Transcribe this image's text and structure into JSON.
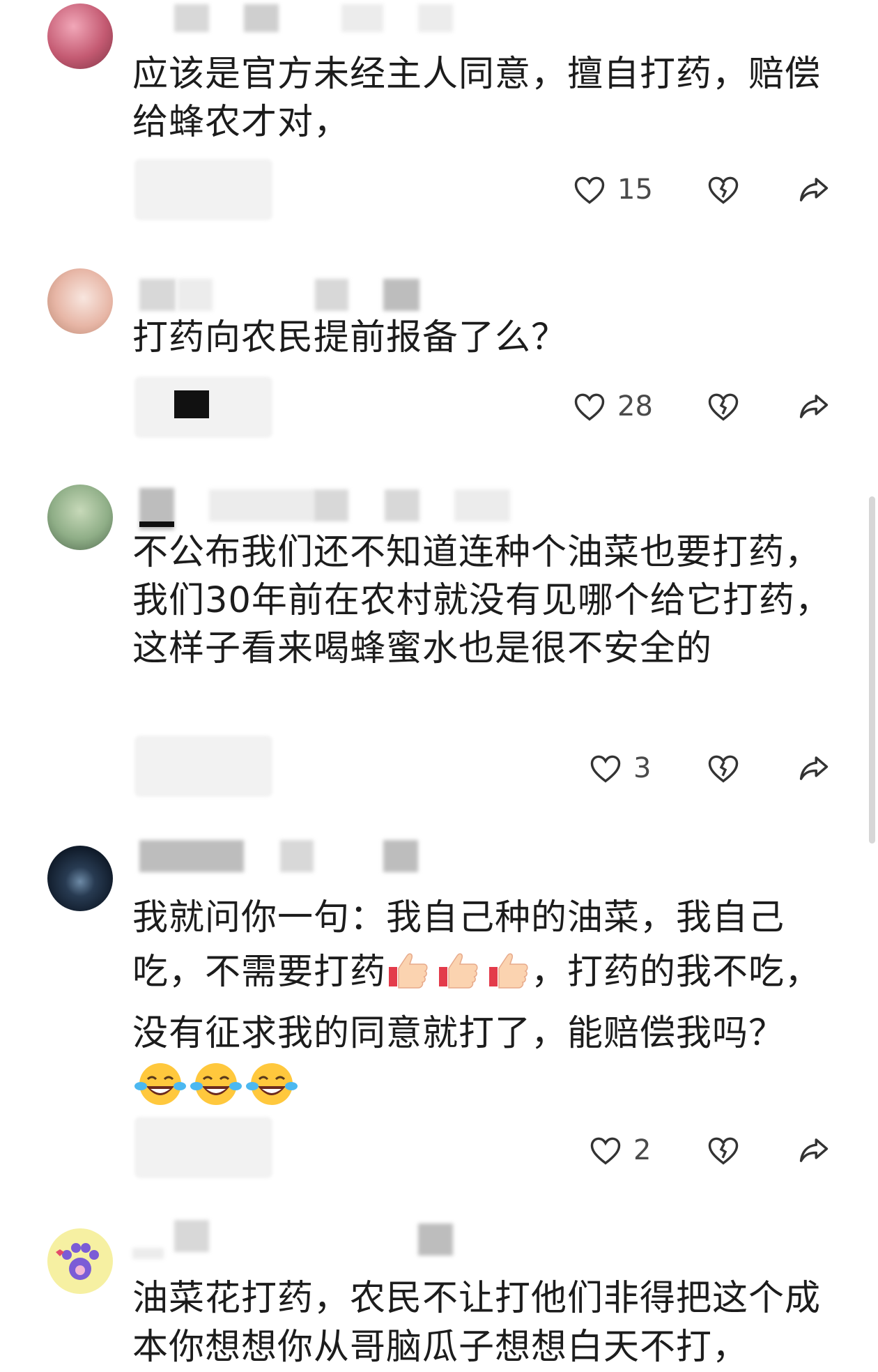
{
  "comments": [
    {
      "text": "应该是官方未经主人同意，擅自打药，赔偿给蜂农才对，",
      "likes": "15"
    },
    {
      "text": "打药向农民提前报备了么？",
      "likes": "28"
    },
    {
      "text": "不公布我们还不知道连种个油菜也要打药，我们30年前在农村就没有见哪个给它打药， 这样子看来喝蜂蜜水也是很不安全的",
      "likes": "3"
    },
    {
      "text_a": "我就问你一句：我自己种的油菜，我自己吃，不需要打药",
      "text_b": "，打药的我不吃，没有征求我的同意就打了，能赔偿我吗？",
      "likes": "2"
    },
    {
      "text": "油菜花打药，农民不让打他们非得把这个成本你想想你从哥脑瓜子想想白天不打，"
    }
  ],
  "icons": {
    "like": "heart-outline-icon",
    "dislike": "broken-heart-icon",
    "share": "share-arrow-icon",
    "thumbs_up": "thumbs-up-emoji",
    "laugh": "tears-of-joy-emoji"
  }
}
